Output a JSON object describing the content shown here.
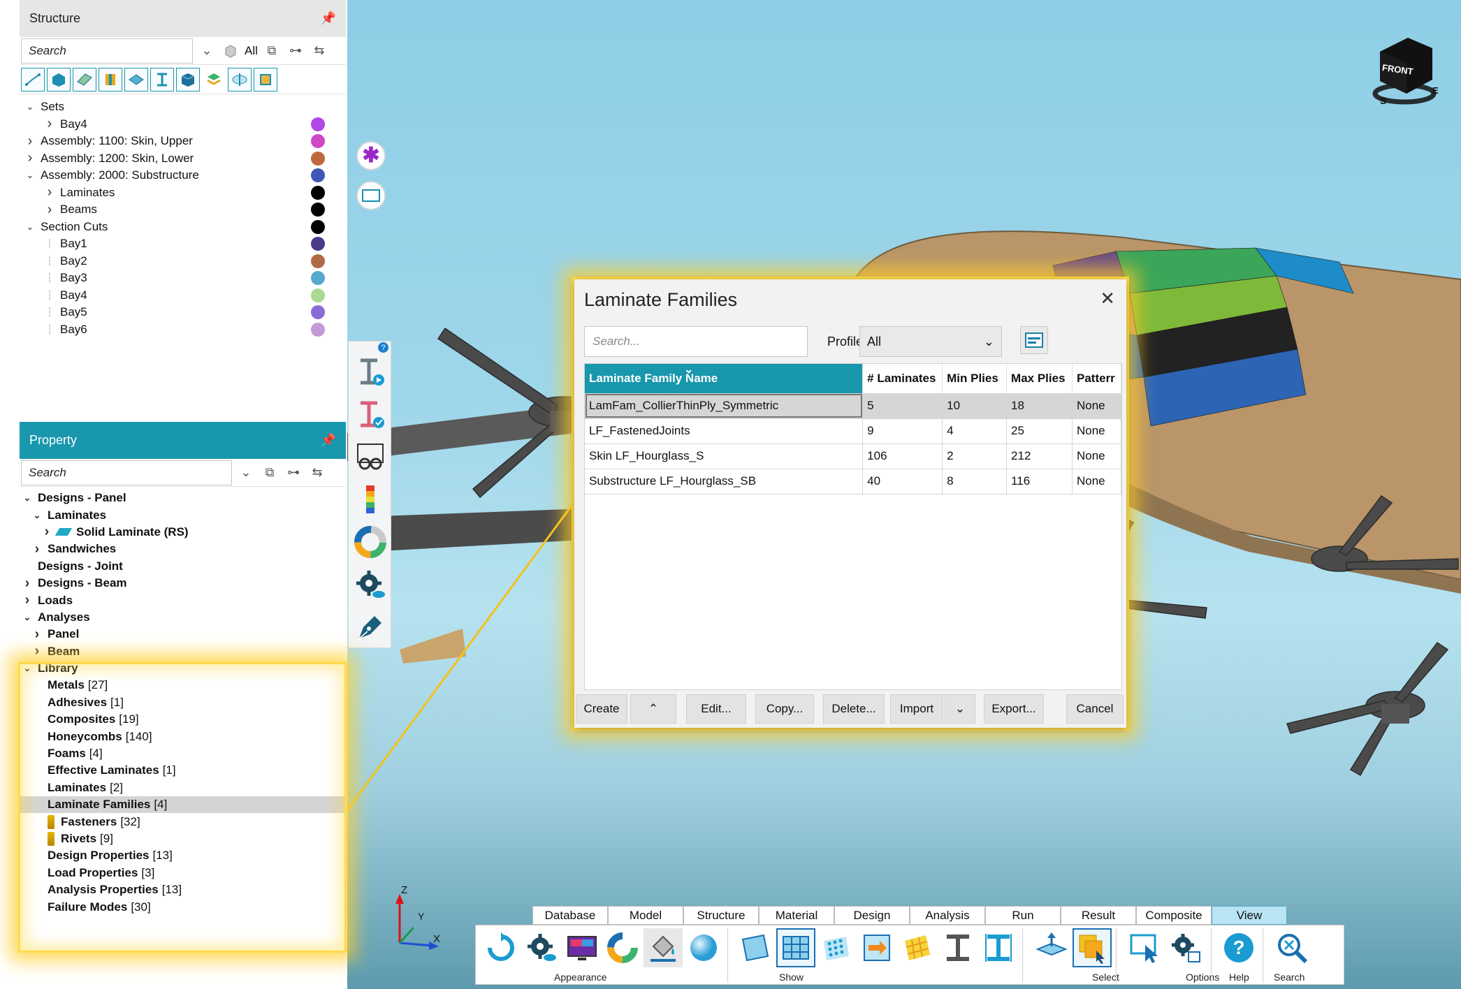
{
  "structure": {
    "title": "Structure",
    "search_placeholder": "Search",
    "all_label": "All",
    "tree": [
      {
        "label": "Sets",
        "level": 0,
        "toggle": "down",
        "color": null
      },
      {
        "label": "Bay4",
        "level": 1,
        "toggle": "right",
        "color": "#b347e6"
      },
      {
        "label": "Assembly: 1100: Skin, Upper",
        "level": 0,
        "toggle": "right",
        "color": "#cf48c8"
      },
      {
        "label": "Assembly: 1200: Skin, Lower",
        "level": 0,
        "toggle": "right",
        "color": "#c0673c"
      },
      {
        "label": "Assembly: 2000: Substructure",
        "level": 0,
        "toggle": "down",
        "color": "#3f58b5"
      },
      {
        "label": "Laminates",
        "level": 1,
        "toggle": "right",
        "color": "#000000"
      },
      {
        "label": "Beams",
        "level": 1,
        "toggle": "right",
        "color": "#000000"
      },
      {
        "label": "Section Cuts",
        "level": 0,
        "toggle": "down",
        "color": "#000000"
      },
      {
        "label": "Bay1",
        "level": 1,
        "toggle": "line",
        "color": "#4b3a8a"
      },
      {
        "label": "Bay2",
        "level": 1,
        "toggle": "line",
        "color": "#b06a45"
      },
      {
        "label": "Bay3",
        "level": 1,
        "toggle": "line",
        "color": "#56a8cc"
      },
      {
        "label": "Bay4",
        "level": 1,
        "toggle": "line",
        "color": "#a9da90"
      },
      {
        "label": "Bay5",
        "level": 1,
        "toggle": "line",
        "color": "#8a6bd6"
      },
      {
        "label": "Bay6",
        "level": 1,
        "toggle": "line",
        "color": "#c49ad6"
      }
    ]
  },
  "property": {
    "title": "Property",
    "search_placeholder": "Search",
    "tree": [
      {
        "label": "Designs - Panel",
        "count": "",
        "level": 0,
        "toggle": "down"
      },
      {
        "label": "Laminates",
        "count": "",
        "level": 1,
        "toggle": "down"
      },
      {
        "label": "Solid Laminate (RS)",
        "count": "",
        "level": 2,
        "toggle": "right",
        "icon": "gem"
      },
      {
        "label": "Sandwiches",
        "count": "",
        "level": 1,
        "toggle": "right"
      },
      {
        "label": "Designs - Joint",
        "count": "",
        "level": 0,
        "toggle": "none"
      },
      {
        "label": "Designs - Beam",
        "count": "",
        "level": 0,
        "toggle": "right"
      },
      {
        "label": "Loads",
        "count": "",
        "level": 0,
        "toggle": "right"
      },
      {
        "label": "Analyses",
        "count": "",
        "level": 0,
        "toggle": "down"
      },
      {
        "label": "Panel",
        "count": "",
        "level": 1,
        "toggle": "right"
      },
      {
        "label": "Beam",
        "count": "",
        "level": 1,
        "toggle": "right"
      },
      {
        "label": "Library",
        "count": "",
        "level": 0,
        "toggle": "down"
      },
      {
        "label": "Metals",
        "count": "[27]",
        "level": 1,
        "toggle": "none"
      },
      {
        "label": "Adhesives",
        "count": "[1]",
        "level": 1,
        "toggle": "none"
      },
      {
        "label": "Composites",
        "count": "[19]",
        "level": 1,
        "toggle": "none"
      },
      {
        "label": "Honeycombs",
        "count": "[140]",
        "level": 1,
        "toggle": "none"
      },
      {
        "label": "Foams",
        "count": "[4]",
        "level": 1,
        "toggle": "none"
      },
      {
        "label": "Effective Laminates",
        "count": "[1]",
        "level": 1,
        "toggle": "none"
      },
      {
        "label": "Laminates",
        "count": "[2]",
        "level": 1,
        "toggle": "none"
      },
      {
        "label": "Laminate Families",
        "count": "[4]",
        "level": 1,
        "toggle": "none",
        "selected": true
      },
      {
        "label": "Fasteners",
        "count": "[32]",
        "level": 1,
        "toggle": "none",
        "icon": "pin"
      },
      {
        "label": "Rivets",
        "count": "[9]",
        "level": 1,
        "toggle": "none",
        "icon": "pin"
      },
      {
        "label": "Design Properties",
        "count": "[13]",
        "level": 1,
        "toggle": "none"
      },
      {
        "label": "Load Properties",
        "count": "[3]",
        "level": 1,
        "toggle": "none"
      },
      {
        "label": "Analysis Properties",
        "count": "[13]",
        "level": 1,
        "toggle": "none"
      },
      {
        "label": "Failure Modes",
        "count": "[30]",
        "level": 1,
        "toggle": "none"
      }
    ]
  },
  "dialog": {
    "title": "Laminate Families",
    "search_placeholder": "Search...",
    "profile_label": "Profile:",
    "profile_value": "All",
    "columns": [
      "Laminate Family Name",
      "# Laminates",
      "Min Plies",
      "Max Plies",
      "Patterr"
    ],
    "rows": [
      [
        "LamFam_CollierThinPly_Symmetric",
        "5",
        "10",
        "18",
        "None"
      ],
      [
        "LF_FastenedJoints",
        "9",
        "4",
        "25",
        "None"
      ],
      [
        "Skin LF_Hourglass_S",
        "106",
        "2",
        "212",
        "None"
      ],
      [
        "Substructure LF_Hourglass_SB",
        "40",
        "8",
        "116",
        "None"
      ]
    ],
    "buttons": {
      "create": "Create",
      "edit": "Edit...",
      "copy": "Copy...",
      "delete": "Delete...",
      "import": "Import",
      "export": "Export...",
      "cancel": "Cancel"
    }
  },
  "ribbon": {
    "tabs": [
      "Database",
      "Model",
      "Structure",
      "Material",
      "Design",
      "Analysis",
      "Run",
      "Result",
      "Composite",
      "View"
    ],
    "active_tab": "View",
    "groups": {
      "appearance": "Appearance",
      "show": "Show",
      "select": "Select",
      "options": "Options",
      "help": "Help",
      "search": "Search"
    }
  },
  "nav_cube": {
    "face": "FRONT",
    "compass_s": "S",
    "compass_e": "E"
  },
  "axis": {
    "z": "Z",
    "y": "Y",
    "x": "X"
  },
  "colors": {
    "accent": "#1897ad",
    "highlight": "#ffd94a",
    "active_tab": "#b9e4f3"
  }
}
